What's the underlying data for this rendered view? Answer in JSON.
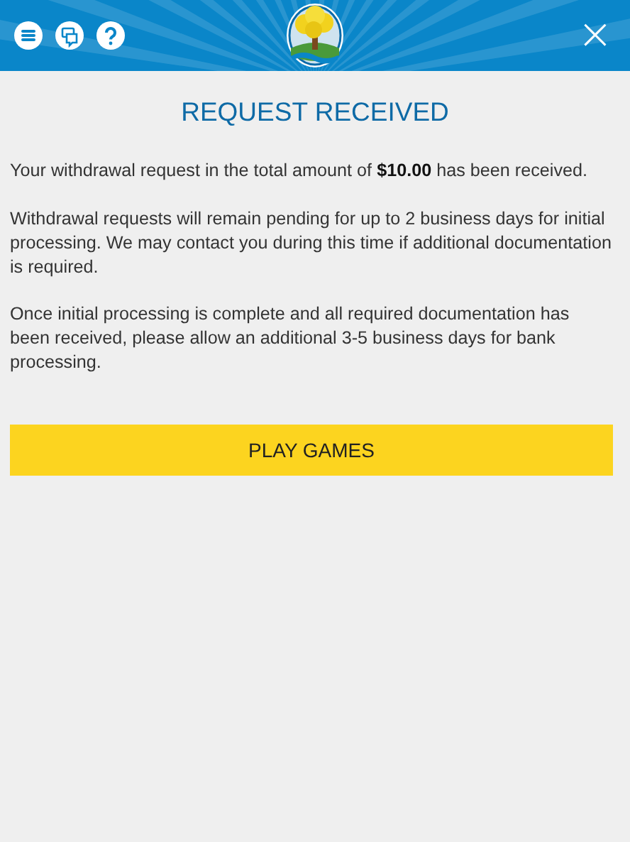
{
  "header": {
    "close": "×"
  },
  "dialog": {
    "title": "REQUEST RECEIVED",
    "paragraphs": [
      "Your withdrawal request in the total amount of **$10.00** has been received.",
      "Withdrawal requests will remain pending for up to 2 business days for initial processing. We may contact you during this time if additional documentation is required.",
      "Once initial processing is complete and all required documentation has been received, please allow an additional 3-5 business days for bank processing."
    ],
    "button": "PLAY GAMES"
  }
}
